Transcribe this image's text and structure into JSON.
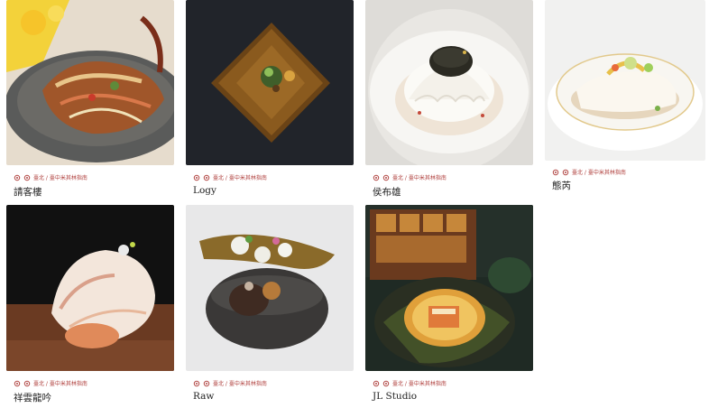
{
  "distinction_icon": "michelin-star-icon",
  "accent_color": "#b0413e",
  "restaurants": [
    {
      "name": "請客樓",
      "location": "臺北 / 臺中米其林指南",
      "stars": 2
    },
    {
      "name": "Logy",
      "location": "臺北 / 臺中米其林指南",
      "stars": 2
    },
    {
      "name": "侯布雄",
      "location": "臺北 / 臺中米其林指南",
      "stars": 2
    },
    {
      "name": "態芮",
      "location": "臺北 / 臺中米其林指南",
      "stars": 2
    },
    {
      "name": "祥雲龍吟",
      "location": "臺北 / 臺中米其林指南",
      "stars": 2
    },
    {
      "name": "Raw",
      "location": "臺北 / 臺中米其林指南",
      "stars": 2
    },
    {
      "name": "JL Studio",
      "location": "臺北 / 臺中米其林指南",
      "stars": 2
    }
  ]
}
